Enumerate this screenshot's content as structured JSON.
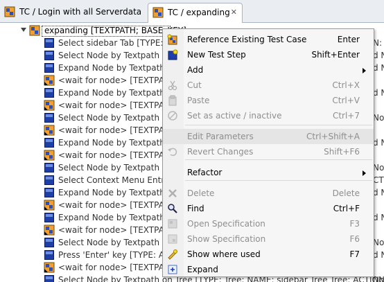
{
  "tabs": [
    {
      "label": "TC / Login with all Serverdata",
      "icon": "test-case-icon",
      "active": false
    },
    {
      "label": "TC / expanding",
      "icon": "test-case-icon",
      "active": true,
      "close_glyph": "✕"
    }
  ],
  "tree": {
    "root": {
      "label": "expanding [TEXTPATH; BASE_KEY]",
      "icon": "test-case-icon",
      "expanded": true
    },
    "children": [
      {
        "label": "Select sidebar Tab [TYPE: Tab",
        "icon": "test-step-icon"
      },
      {
        "label": "Select Node by Textpath on T",
        "icon": "test-step-icon"
      },
      {
        "label": "Expand Node by Textpath on",
        "icon": "test-step-icon"
      },
      {
        "label": "<wait for node> [TEXTPATH",
        "icon": "referenced-test-case-icon"
      },
      {
        "label": "Expand Node by Textpath on",
        "icon": "test-step-icon"
      },
      {
        "label": "<wait for node> [TEXTPATH",
        "icon": "referenced-test-case-icon"
      },
      {
        "label": "Select Node by Textpath on T",
        "icon": "test-step-icon"
      },
      {
        "label": "<wait for node> [TEXTPATH",
        "icon": "referenced-test-case-icon"
      },
      {
        "label": "Expand Node by Textpath on",
        "icon": "test-step-icon"
      },
      {
        "label": "<wait for node> [TEXTPATH",
        "icon": "referenced-test-case-icon"
      },
      {
        "label": "Select Node by Textpath on T",
        "icon": "test-step-icon"
      },
      {
        "label": "Select Context Menu Entry by",
        "icon": "test-step-icon"
      },
      {
        "label": "Expand Node by Textpath on",
        "icon": "test-step-icon"
      },
      {
        "label": "<wait for node> [TEXTPATH",
        "icon": "referenced-test-case-icon"
      },
      {
        "label": "Expand Node by Textpath on",
        "icon": "test-step-icon"
      },
      {
        "label": "<wait for node> [TEXTPATH",
        "icon": "referenced-test-case-icon"
      },
      {
        "label": "Select Node by Textpath on",
        "icon": "test-step-icon"
      },
      {
        "label": "Press 'Enter' key [TYPE: Appli",
        "icon": "test-step-icon"
      },
      {
        "label": "<wait for node> [TEXTPATH",
        "icon": "referenced-test-case-icon"
      },
      {
        "label": "Select Node by Textpath on Tree [TYPE: Tree; NAME: sidebar Tree Tree; ACTION: Select Node",
        "icon": "test-step-icon"
      }
    ],
    "right_fragments": [
      "",
      "N:",
      "d N",
      "d N",
      "",
      "d N",
      "",
      "Noc",
      "",
      "d N",
      "",
      "Noc",
      "CTI",
      "d N",
      "",
      "d N",
      "",
      "Noc",
      "d N",
      "",
      "Noc"
    ]
  },
  "context_menu": {
    "items": [
      {
        "label": "Reference Existing Test Case",
        "shortcut": "Enter",
        "icon": "reference-test-case-icon",
        "disabled": false
      },
      {
        "label": "New Test Step",
        "shortcut": "Shift+Enter",
        "icon": "new-test-step-icon",
        "disabled": false
      },
      {
        "label": "Add",
        "shortcut": "",
        "icon": "",
        "disabled": false,
        "submenu": true
      },
      {
        "label": "Cut",
        "shortcut": "Ctrl+X",
        "icon": "cut-icon",
        "disabled": true
      },
      {
        "label": "Paste",
        "shortcut": "Ctrl+V",
        "icon": "paste-icon",
        "disabled": true
      },
      {
        "label": "Set as active / inactive",
        "shortcut": "Ctrl+7",
        "icon": "toggle-active-icon",
        "disabled": true
      },
      {
        "label": "Edit Parameters",
        "shortcut": "Ctrl+Shift+A",
        "icon": "",
        "disabled": true,
        "highlighted": true
      },
      {
        "label": "Revert Changes",
        "shortcut": "Shift+F6",
        "icon": "revert-icon",
        "disabled": true
      },
      {
        "label": "Refactor",
        "shortcut": "",
        "icon": "",
        "disabled": false,
        "submenu": true
      },
      {
        "label": "Delete",
        "shortcut": "Delete",
        "icon": "delete-icon",
        "disabled": true
      },
      {
        "label": "Find",
        "shortcut": "Ctrl+F",
        "icon": "find-icon",
        "disabled": false
      },
      {
        "label": "Open Specification",
        "shortcut": "F3",
        "icon": "open-specification-icon",
        "disabled": true
      },
      {
        "label": "Show Specification",
        "shortcut": "F6",
        "icon": "show-specification-icon",
        "disabled": true
      },
      {
        "label": "Show where used",
        "shortcut": "F7",
        "icon": "show-where-used-icon",
        "disabled": false
      },
      {
        "label": "Expand",
        "shortcut": "",
        "icon": "expand-icon",
        "disabled": false
      }
    ]
  },
  "colors": {
    "test_step_blue": "#1f3fa8",
    "test_case_orange": "#f0a030",
    "disabled_text": "#8e8e8e",
    "menu_bg": "#f6f6f6"
  }
}
